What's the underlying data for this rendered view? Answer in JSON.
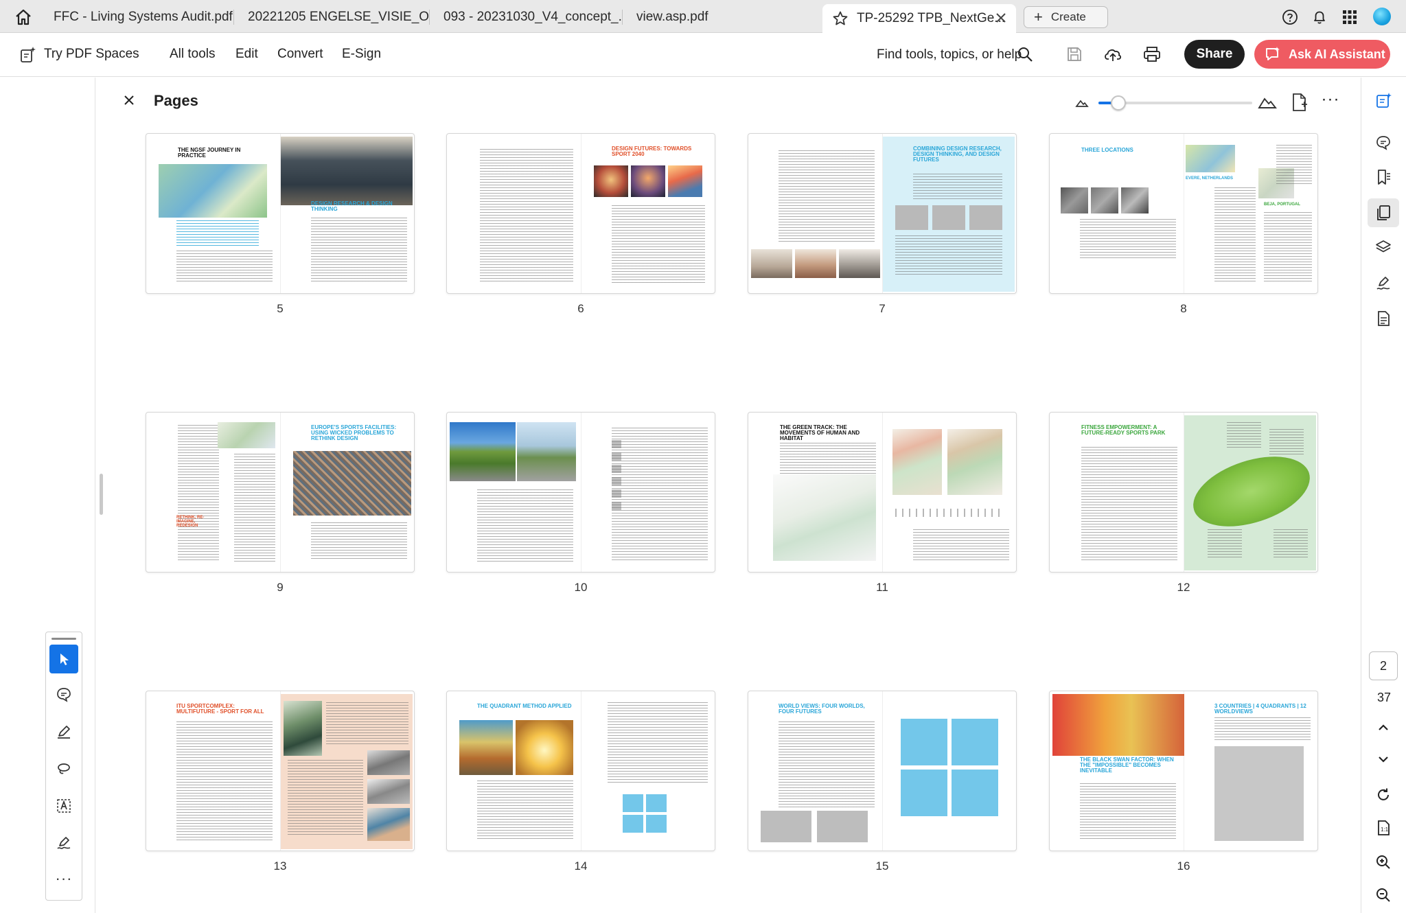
{
  "tabs": [
    {
      "title": "FFC - Living Systems Audit.pdf"
    },
    {
      "title": "20221205 ENGELSE_VISIE_OP..."
    },
    {
      "title": "093 - 20231030_V4_concept_..."
    },
    {
      "title": "view.asp.pdf"
    },
    {
      "title": "TP-25292 TPB_NextGe..."
    }
  ],
  "create_label": "Create",
  "toolbar": {
    "spaces": "Try PDF Spaces",
    "all_tools": "All tools",
    "edit": "Edit",
    "convert": "Convert",
    "esign": "E-Sign",
    "find": "Find tools, topics, or help",
    "share": "Share",
    "ai": "Ask AI Assistant"
  },
  "panel": {
    "title": "Pages",
    "zoom_level_fraction": 0.13
  },
  "pages": [
    {
      "number": "5",
      "headings": [
        "THE NGSF JOURNEY IN PRACTICE",
        "DESIGN RESEARCH & DESIGN THINKING"
      ]
    },
    {
      "number": "6",
      "headings": [
        "DESIGN FUTURES: TOWARDS SPORT 2040"
      ]
    },
    {
      "number": "7",
      "headings": [
        "COMBINING DESIGN RESEARCH, DESIGN THINKING, AND DESIGN FUTURES"
      ]
    },
    {
      "number": "8",
      "headings": [
        "THREE LOCATIONS",
        "EVERE, NETHERLANDS",
        "BEJA, PORTUGAL"
      ]
    },
    {
      "number": "9",
      "headings": [
        "EUROPE'S SPORTS FACILITIES: USING WICKED PROBLEMS TO RETHINK DESIGN",
        "RETHINK, RE-IMAGINE, REDESIGN"
      ]
    },
    {
      "number": "10",
      "headings": []
    },
    {
      "number": "11",
      "headings": [
        "THE GREEN TRACK: THE MOVEMENTS OF HUMAN AND HABITAT"
      ]
    },
    {
      "number": "12",
      "headings": [
        "FITNESS EMPOWERMENT: A FUTURE-READY SPORTS PARK"
      ]
    },
    {
      "number": "13",
      "headings": [
        "ITU SPORTCOMPLEX: MULTIFUTURE - SPORT FOR ALL"
      ]
    },
    {
      "number": "14",
      "headings": [
        "THE QUADRANT METHOD APPLIED"
      ]
    },
    {
      "number": "15",
      "headings": [
        "WORLD VIEWS: FOUR WORLDS, FOUR FUTURES"
      ]
    },
    {
      "number": "16",
      "headings": [
        "3 COUNTRIES | 4 QUADRANTS | 12 WORLDVIEWS",
        "THE BLACK SWAN FACTOR: WHEN THE \"IMPOSSIBLE\" BECOMES INEVITABLE"
      ]
    }
  ],
  "page_nav": {
    "current": "2",
    "total": "37"
  },
  "colors": {
    "accent": "#1473e6",
    "ai_button": "#ef5b62",
    "share_button": "#1f1f1f",
    "heading_blue": "#2aa6d8",
    "heading_orange": "#e0502a",
    "heading_green": "#3aa63c"
  },
  "icons": [
    "home-icon",
    "star-icon",
    "close-icon",
    "help-icon",
    "bell-icon",
    "apps-grid-icon",
    "search-icon",
    "save-icon",
    "cloud-upload-icon",
    "print-icon",
    "select-arrow-icon",
    "comment-icon",
    "pen-icon",
    "lasso-icon",
    "text-box-icon",
    "sign-icon",
    "more-icon"
  ]
}
